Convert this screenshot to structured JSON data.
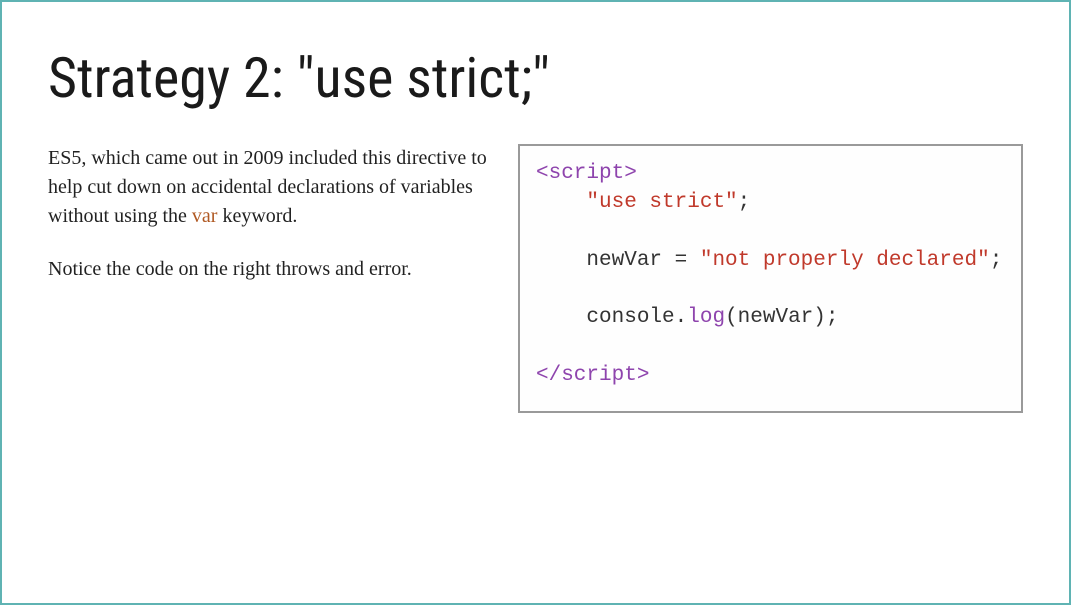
{
  "title": "Strategy 2: \"use strict;\"",
  "paragraphs": {
    "p1_a": "ES5, which came out in 2009 included this directive to help cut down on accidental declarations of variables without using the ",
    "p1_var": "var",
    "p1_b": " keyword.",
    "p2": "Notice the code on the right throws and error."
  },
  "code": {
    "l1_open": "<script>",
    "l2_str": "\"use strict\"",
    "l2_semi": ";",
    "l4_a": "newVar = ",
    "l4_str": "\"not properly declared\"",
    "l4_semi": ";",
    "l6_a": "console.",
    "l6_fn": "log",
    "l6_b": "(newVar);",
    "l8_close": "</scr"
  },
  "code_close_tail": "ipt>"
}
